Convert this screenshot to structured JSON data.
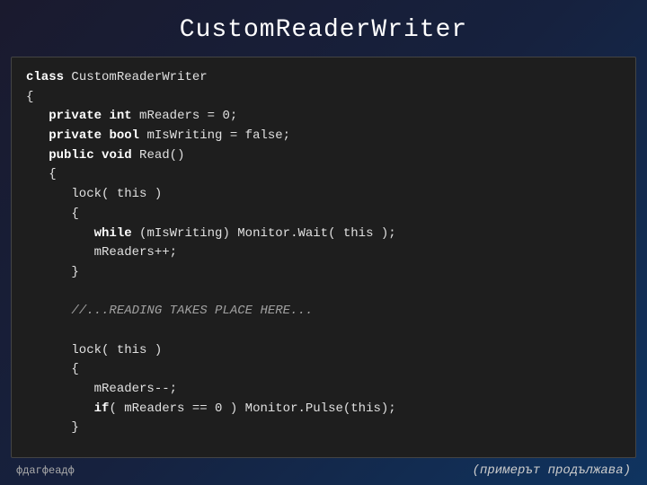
{
  "title": "CustomReaderWriter",
  "code": {
    "lines": [
      {
        "indent": 0,
        "text": "class CustomReaderWriter"
      },
      {
        "indent": 0,
        "text": "{"
      },
      {
        "indent": 1,
        "text": "private int mReaders = 0;"
      },
      {
        "indent": 1,
        "text": "private bool mIsWriting = false;"
      },
      {
        "indent": 1,
        "text": "public void Read()"
      },
      {
        "indent": 1,
        "text": "{"
      },
      {
        "indent": 2,
        "text": "lock( this )"
      },
      {
        "indent": 2,
        "text": "{"
      },
      {
        "indent": 3,
        "text": "while (mIsWriting) Monitor.Wait( this );"
      },
      {
        "indent": 3,
        "text": "mReaders++;"
      },
      {
        "indent": 2,
        "text": "}"
      },
      {
        "indent": 0,
        "text": ""
      },
      {
        "indent": 2,
        "text": "//...READING TAKES PLACE HERE..."
      },
      {
        "indent": 0,
        "text": ""
      },
      {
        "indent": 2,
        "text": "lock( this )"
      },
      {
        "indent": 2,
        "text": "{"
      },
      {
        "indent": 3,
        "text": "mReaders--;"
      },
      {
        "indent": 3,
        "text": "if( mReaders == 0 ) Monitor.Pulse(this);"
      },
      {
        "indent": 2,
        "text": "}"
      }
    ]
  },
  "footer": {
    "left": "фдагфеадф",
    "right": "(примерът продължава)"
  }
}
